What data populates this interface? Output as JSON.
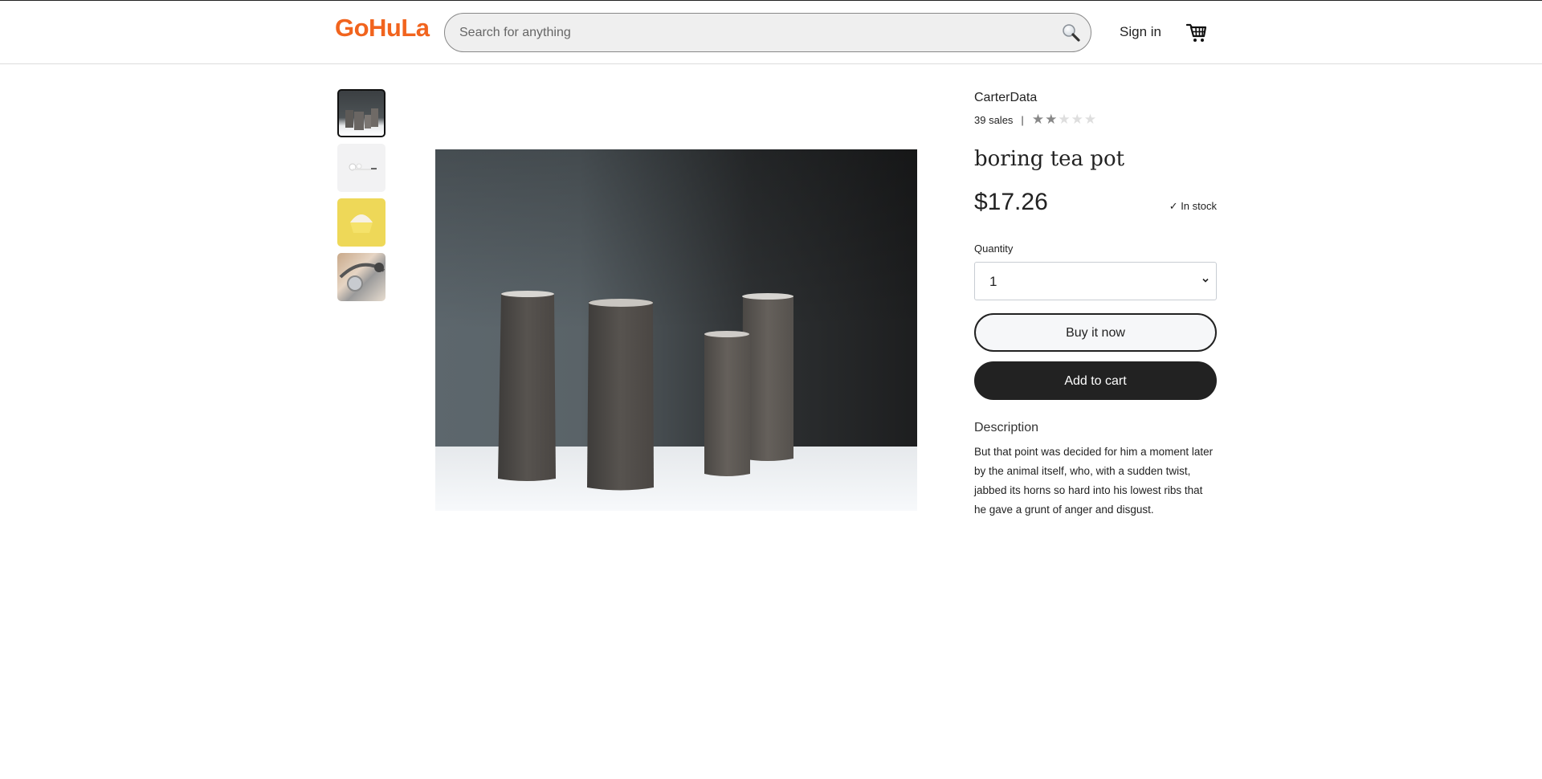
{
  "header": {
    "logo": "GoHuLa",
    "search_placeholder": "Search for anything",
    "search_value": "",
    "sign_in": "Sign in",
    "icons": {
      "search": "search-icon",
      "cart": "cart-icon"
    }
  },
  "gallery": {
    "thumbnails": [
      {
        "alt": "grey ceramic pitchers",
        "active": true
      },
      {
        "alt": "white earbuds",
        "active": false
      },
      {
        "alt": "yellow cupcake",
        "active": false
      },
      {
        "alt": "silver headphones",
        "active": false
      }
    ],
    "main_image_alt": "Four grey ceramic pitchers on a white surface"
  },
  "product": {
    "shop_name": "CarterData",
    "sales": "39 sales",
    "separator": "|",
    "rating": 2,
    "rating_max": 5,
    "star_glyph": "★",
    "title": "boring tea pot",
    "price": "$17.26",
    "stock": "✓ In stock",
    "quantity_label": "Quantity",
    "quantity_value": "1",
    "buy_now": "Buy it now",
    "add_to_cart": "Add to cart",
    "description_heading": "Description",
    "description": "But that point was decided for him a moment later by the animal itself, who, with a sudden twist, jabbed its horns so hard into his lowest ribs that he gave a grunt of anger and disgust."
  },
  "colors": {
    "brand": "#f1641e",
    "primary_button": "#222222",
    "star_filled": "#888888",
    "star_empty": "#dedede"
  }
}
